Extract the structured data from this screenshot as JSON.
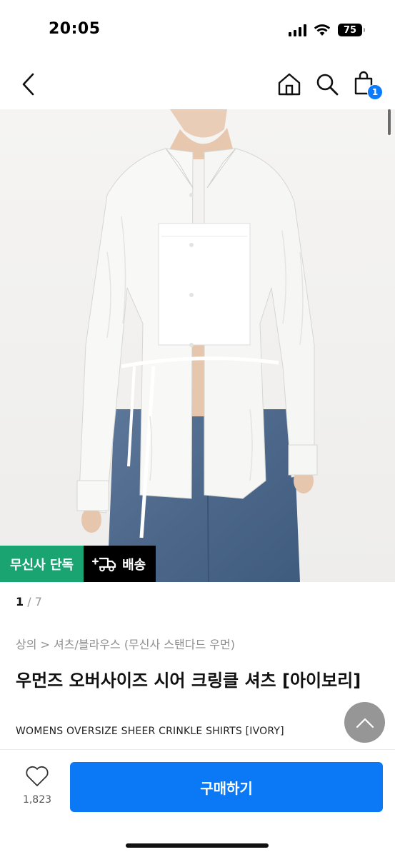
{
  "status_bar": {
    "time": "20:05",
    "battery": "75"
  },
  "nav": {
    "cart_count": "1",
    "icons": [
      "back-arrow-icon",
      "home-icon",
      "search-icon",
      "shopping-bag-icon"
    ]
  },
  "product": {
    "badges": {
      "exclusive": "무신사 단독",
      "delivery": "배송"
    },
    "pager": {
      "current": "1",
      "separator": " / ",
      "total": "7"
    },
    "breadcrumb": "상의 > 셔츠/블라우스 (무신사 스탠다드 우먼)",
    "title_ko": "우먼즈 오버사이즈 시어 크링클 셔츠 [아이보리]",
    "title_en": "WOMENS OVERSIZE SHEER CRINKLE SHIRTS [IVORY]"
  },
  "actions": {
    "like_count": "1,823",
    "buy_label": "구매하기"
  },
  "colors": {
    "accent_blue": "#0b78f5",
    "exclusive_green": "#1aa472",
    "badge_blue": "#0b7cff"
  }
}
